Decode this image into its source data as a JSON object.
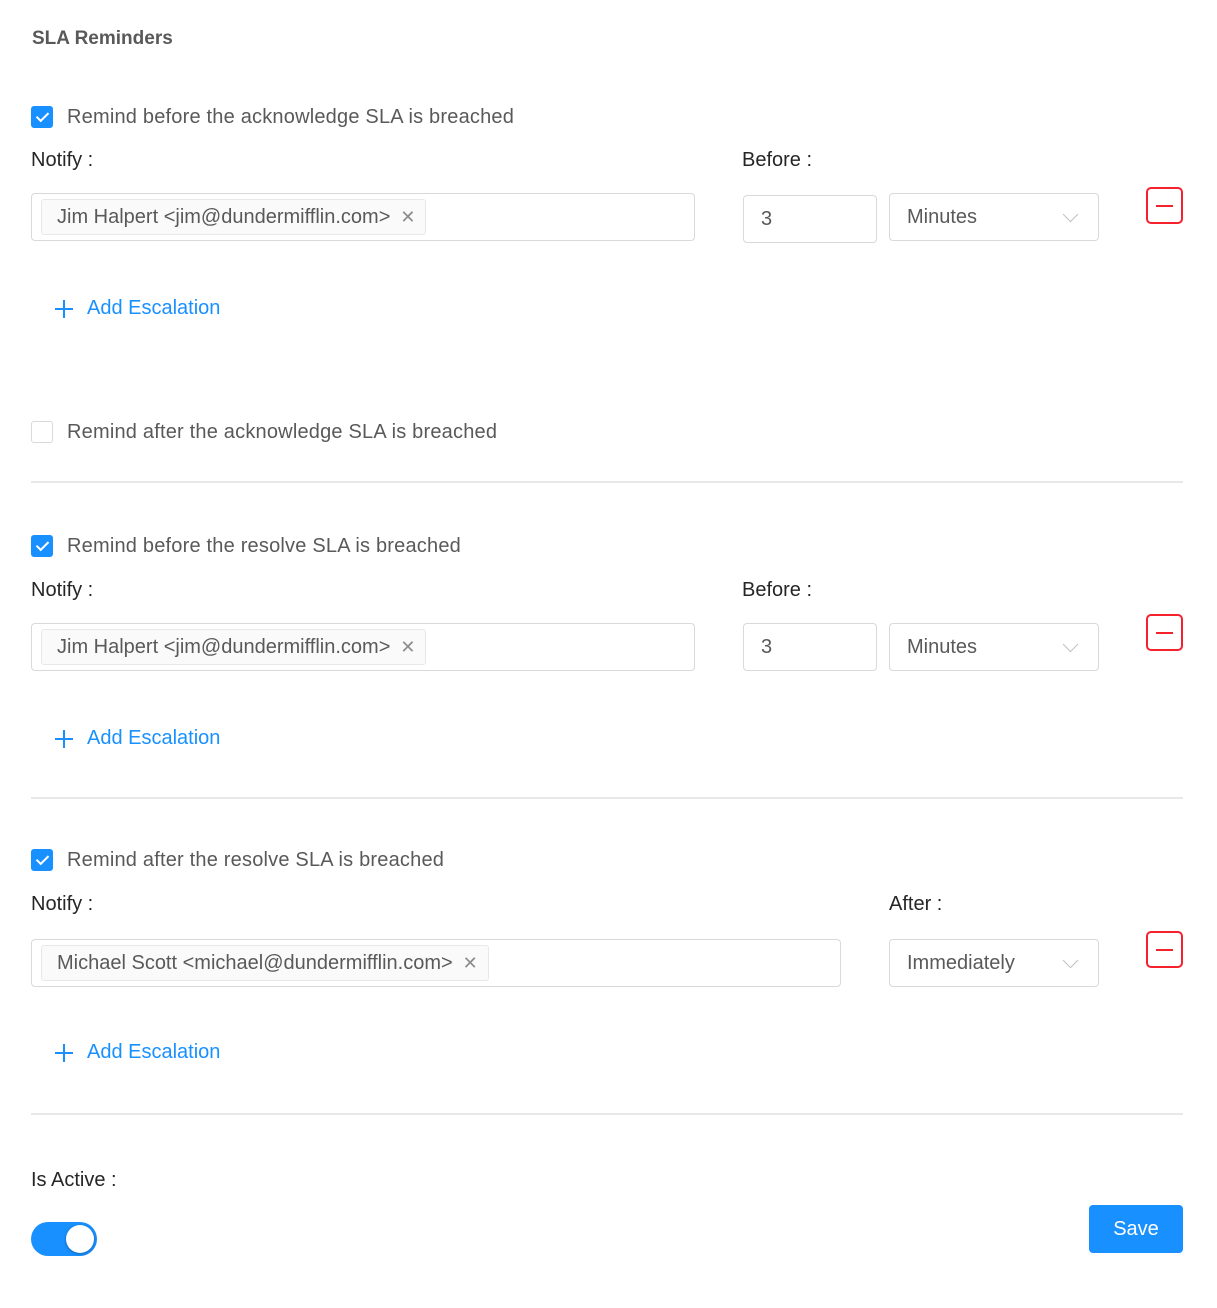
{
  "title": "SLA Reminders",
  "sections": [
    {
      "checkbox_label": "Remind before the acknowledge SLA is breached",
      "checked": true,
      "notify_label": "Notify",
      "time_label": "Before",
      "tag": "Jim Halpert <jim@dundermifflin.com>",
      "amount": "3",
      "unit": "Minutes",
      "add_escalation": "Add Escalation"
    },
    {
      "checkbox_label": "Remind after the acknowledge SLA is breached",
      "checked": false
    },
    {
      "checkbox_label": "Remind before the resolve SLA is breached",
      "checked": true,
      "notify_label": "Notify",
      "time_label": "Before",
      "tag": "Jim Halpert <jim@dundermifflin.com>",
      "amount": "3",
      "unit": "Minutes",
      "add_escalation": "Add Escalation"
    },
    {
      "checkbox_label": "Remind after the resolve SLA is breached",
      "checked": true,
      "notify_label": "Notify",
      "time_label": "After",
      "tag": "Michael Scott <michael@dundermifflin.com>",
      "unit": "Immediately",
      "add_escalation": "Add Escalation"
    }
  ],
  "is_active_label": "Is Active",
  "is_active": true,
  "save_label": "Save",
  "colors": {
    "primary": "#1890ff",
    "danger": "#f5222d",
    "border": "#d9d9d9"
  }
}
